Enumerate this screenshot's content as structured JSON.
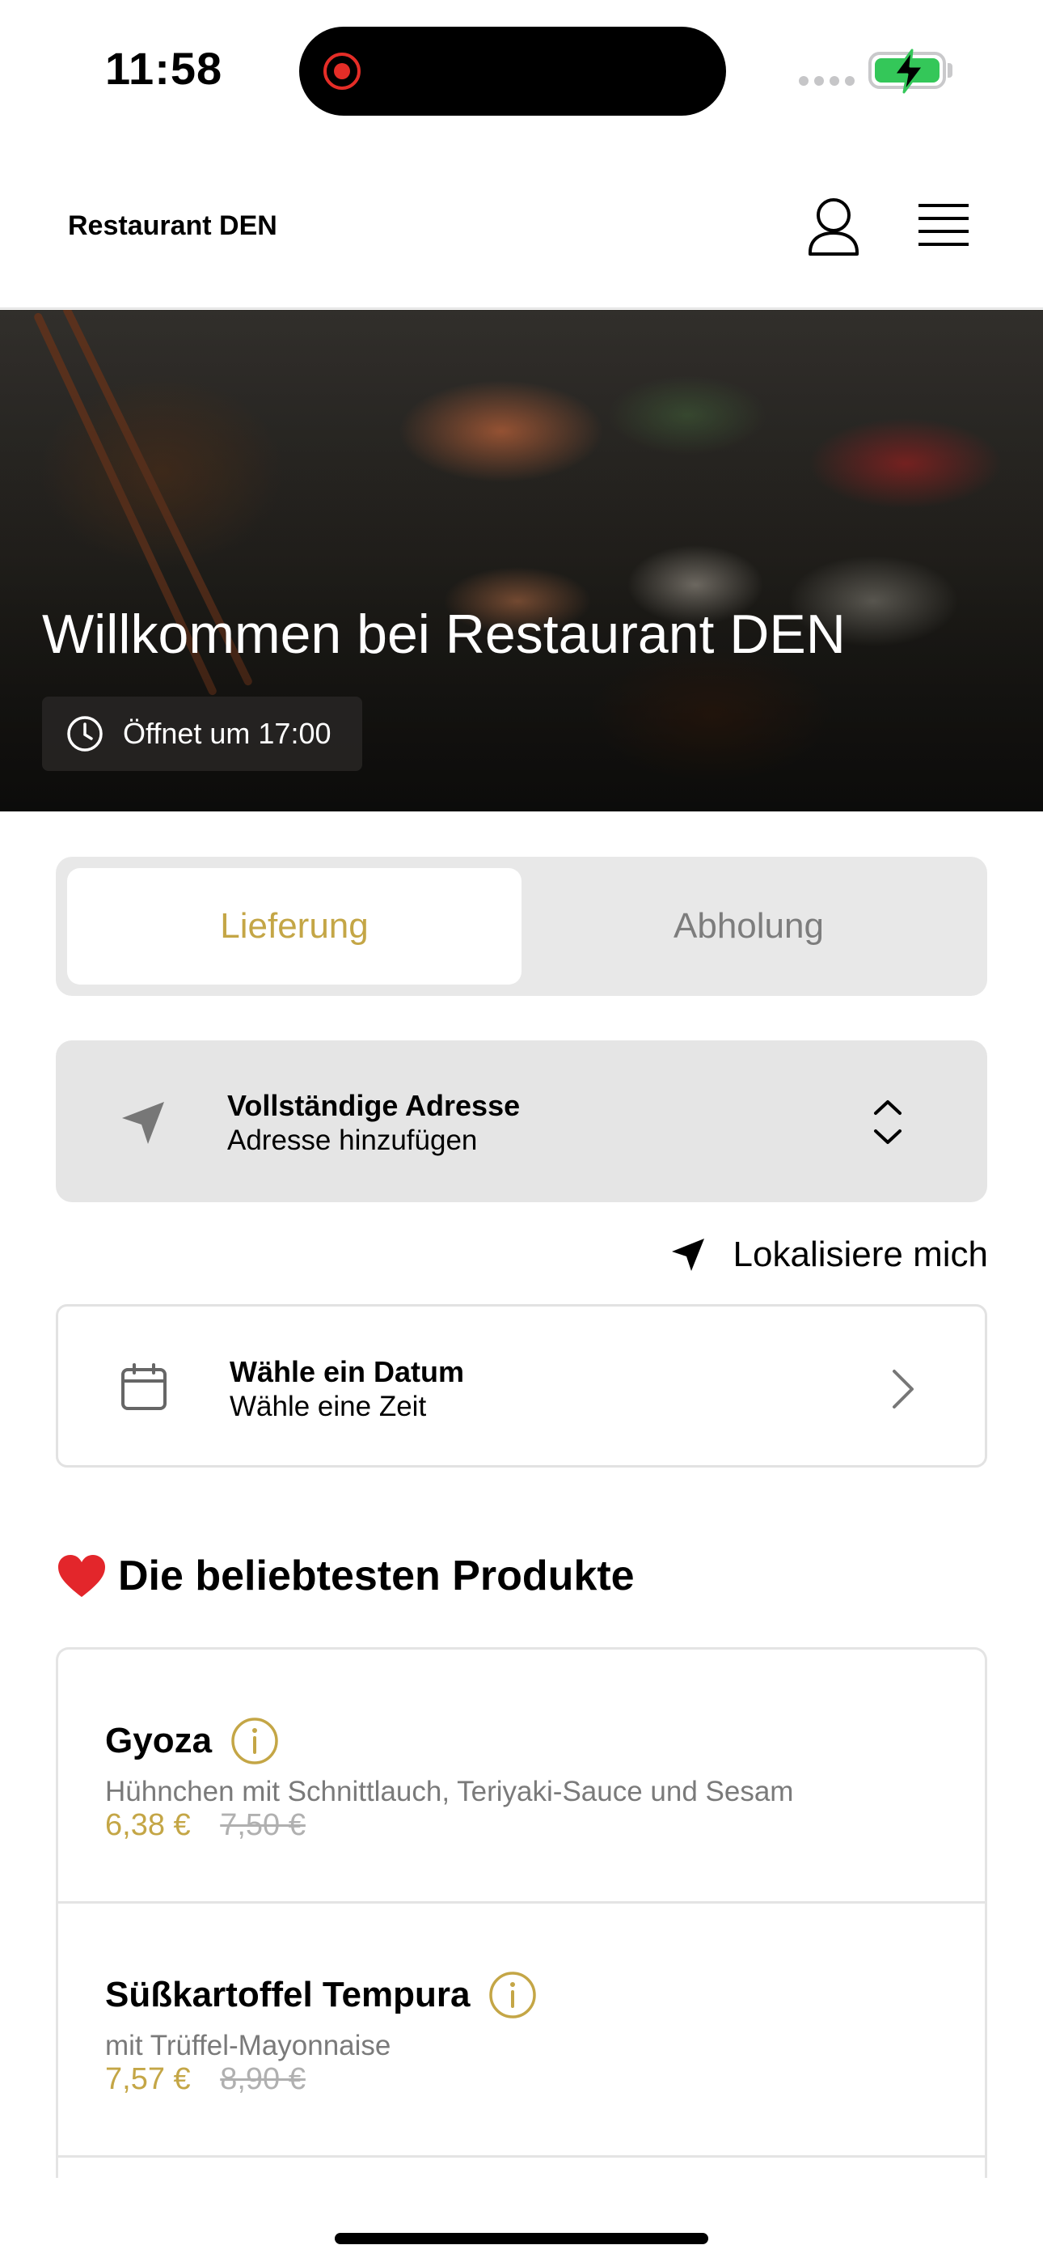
{
  "status_bar": {
    "time": "11:58"
  },
  "header": {
    "title": "Restaurant DEN",
    "user_icon": "user-icon",
    "menu_icon": "menu-icon"
  },
  "hero": {
    "title": "Willkommen bei Restaurant DEN",
    "opening": "Öffnet um 17:00"
  },
  "mode": {
    "tabs": [
      {
        "label": "Lieferung",
        "active": true
      },
      {
        "label": "Abholung",
        "active": false
      }
    ]
  },
  "address": {
    "title": "Vollständige Adresse",
    "subtitle": "Adresse hinzufügen"
  },
  "locate": {
    "label": "Lokalisiere mich"
  },
  "schedule": {
    "title": "Wähle ein Datum",
    "subtitle": "Wähle eine Zeit"
  },
  "popular": {
    "title": "Die beliebtesten Produkte",
    "products": [
      {
        "name": "Gyoza",
        "description": "Hühnchen mit Schnittlauch, Teriyaki-Sauce und Sesam",
        "price": "6,38 €",
        "old_price": "7,50 €"
      },
      {
        "name": "Süßkartoffel Tempura",
        "description": "mit Trüffel-Mayonnaise",
        "price": "7,57 €",
        "old_price": "8,90 €"
      }
    ]
  },
  "colors": {
    "accent": "#c4a646",
    "muted": "#7a7a7a",
    "card_bg": "#e5e5e5"
  }
}
